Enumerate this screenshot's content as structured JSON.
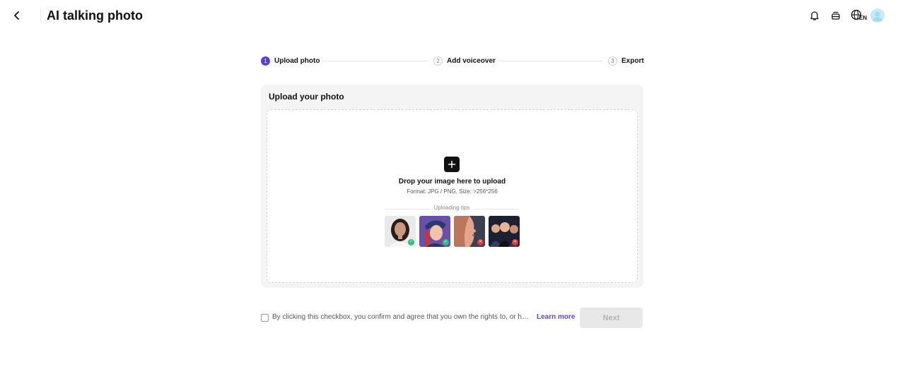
{
  "header": {
    "title": "AI talking photo",
    "language_code": "EN",
    "icons": [
      "chevron-left-icon",
      "bell-icon",
      "stack-icon",
      "globe-icon",
      "avatar"
    ]
  },
  "stepper": {
    "steps": [
      {
        "number": "1",
        "label": "Upload photo",
        "active": true
      },
      {
        "number": "2",
        "label": "Add voiceover",
        "active": false
      },
      {
        "number": "3",
        "label": "Export",
        "active": false
      }
    ]
  },
  "upload": {
    "title": "Upload your photo",
    "drop_title": "Drop your image here to upload",
    "format": "Format: JPG / PNG, Size: >256*256",
    "tips_label": "Uploading tips",
    "examples": [
      {
        "name": "good-portrait",
        "status": "ok"
      },
      {
        "name": "good-cartoon",
        "status": "ok"
      },
      {
        "name": "bad-side-profile",
        "status": "bad"
      },
      {
        "name": "bad-group",
        "status": "bad"
      }
    ]
  },
  "agreement": {
    "text": "By clicking this checkbox, you confirm and agree that you own the rights to, or have obtained the necessary permissions for, the content you upload.",
    "checked": false,
    "learn_more": "Learn more"
  },
  "actions": {
    "next_label": "Next"
  },
  "colors": {
    "accent": "#5b3fd6",
    "card_bg": "#f4f4f5",
    "ok": "#2ec27e",
    "bad": "#e5373b"
  }
}
